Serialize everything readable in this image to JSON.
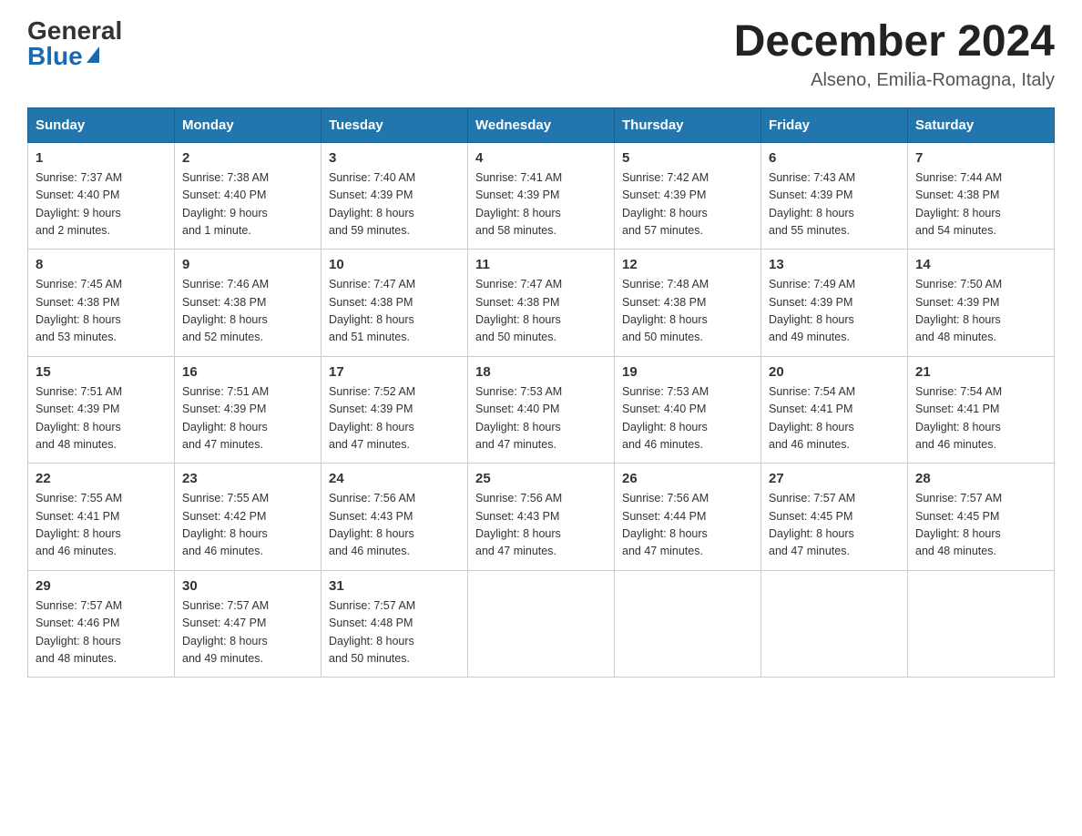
{
  "logo": {
    "general": "General",
    "blue": "Blue"
  },
  "title": "December 2024",
  "subtitle": "Alseno, Emilia-Romagna, Italy",
  "days_of_week": [
    "Sunday",
    "Monday",
    "Tuesday",
    "Wednesday",
    "Thursday",
    "Friday",
    "Saturday"
  ],
  "weeks": [
    [
      {
        "day": "1",
        "sunrise": "7:37 AM",
        "sunset": "4:40 PM",
        "daylight": "9 hours and 2 minutes."
      },
      {
        "day": "2",
        "sunrise": "7:38 AM",
        "sunset": "4:40 PM",
        "daylight": "9 hours and 1 minute."
      },
      {
        "day": "3",
        "sunrise": "7:40 AM",
        "sunset": "4:39 PM",
        "daylight": "8 hours and 59 minutes."
      },
      {
        "day": "4",
        "sunrise": "7:41 AM",
        "sunset": "4:39 PM",
        "daylight": "8 hours and 58 minutes."
      },
      {
        "day": "5",
        "sunrise": "7:42 AM",
        "sunset": "4:39 PM",
        "daylight": "8 hours and 57 minutes."
      },
      {
        "day": "6",
        "sunrise": "7:43 AM",
        "sunset": "4:39 PM",
        "daylight": "8 hours and 55 minutes."
      },
      {
        "day": "7",
        "sunrise": "7:44 AM",
        "sunset": "4:38 PM",
        "daylight": "8 hours and 54 minutes."
      }
    ],
    [
      {
        "day": "8",
        "sunrise": "7:45 AM",
        "sunset": "4:38 PM",
        "daylight": "8 hours and 53 minutes."
      },
      {
        "day": "9",
        "sunrise": "7:46 AM",
        "sunset": "4:38 PM",
        "daylight": "8 hours and 52 minutes."
      },
      {
        "day": "10",
        "sunrise": "7:47 AM",
        "sunset": "4:38 PM",
        "daylight": "8 hours and 51 minutes."
      },
      {
        "day": "11",
        "sunrise": "7:47 AM",
        "sunset": "4:38 PM",
        "daylight": "8 hours and 50 minutes."
      },
      {
        "day": "12",
        "sunrise": "7:48 AM",
        "sunset": "4:38 PM",
        "daylight": "8 hours and 50 minutes."
      },
      {
        "day": "13",
        "sunrise": "7:49 AM",
        "sunset": "4:39 PM",
        "daylight": "8 hours and 49 minutes."
      },
      {
        "day": "14",
        "sunrise": "7:50 AM",
        "sunset": "4:39 PM",
        "daylight": "8 hours and 48 minutes."
      }
    ],
    [
      {
        "day": "15",
        "sunrise": "7:51 AM",
        "sunset": "4:39 PM",
        "daylight": "8 hours and 48 minutes."
      },
      {
        "day": "16",
        "sunrise": "7:51 AM",
        "sunset": "4:39 PM",
        "daylight": "8 hours and 47 minutes."
      },
      {
        "day": "17",
        "sunrise": "7:52 AM",
        "sunset": "4:39 PM",
        "daylight": "8 hours and 47 minutes."
      },
      {
        "day": "18",
        "sunrise": "7:53 AM",
        "sunset": "4:40 PM",
        "daylight": "8 hours and 47 minutes."
      },
      {
        "day": "19",
        "sunrise": "7:53 AM",
        "sunset": "4:40 PM",
        "daylight": "8 hours and 46 minutes."
      },
      {
        "day": "20",
        "sunrise": "7:54 AM",
        "sunset": "4:41 PM",
        "daylight": "8 hours and 46 minutes."
      },
      {
        "day": "21",
        "sunrise": "7:54 AM",
        "sunset": "4:41 PM",
        "daylight": "8 hours and 46 minutes."
      }
    ],
    [
      {
        "day": "22",
        "sunrise": "7:55 AM",
        "sunset": "4:41 PM",
        "daylight": "8 hours and 46 minutes."
      },
      {
        "day": "23",
        "sunrise": "7:55 AM",
        "sunset": "4:42 PM",
        "daylight": "8 hours and 46 minutes."
      },
      {
        "day": "24",
        "sunrise": "7:56 AM",
        "sunset": "4:43 PM",
        "daylight": "8 hours and 46 minutes."
      },
      {
        "day": "25",
        "sunrise": "7:56 AM",
        "sunset": "4:43 PM",
        "daylight": "8 hours and 47 minutes."
      },
      {
        "day": "26",
        "sunrise": "7:56 AM",
        "sunset": "4:44 PM",
        "daylight": "8 hours and 47 minutes."
      },
      {
        "day": "27",
        "sunrise": "7:57 AM",
        "sunset": "4:45 PM",
        "daylight": "8 hours and 47 minutes."
      },
      {
        "day": "28",
        "sunrise": "7:57 AM",
        "sunset": "4:45 PM",
        "daylight": "8 hours and 48 minutes."
      }
    ],
    [
      {
        "day": "29",
        "sunrise": "7:57 AM",
        "sunset": "4:46 PM",
        "daylight": "8 hours and 48 minutes."
      },
      {
        "day": "30",
        "sunrise": "7:57 AM",
        "sunset": "4:47 PM",
        "daylight": "8 hours and 49 minutes."
      },
      {
        "day": "31",
        "sunrise": "7:57 AM",
        "sunset": "4:48 PM",
        "daylight": "8 hours and 50 minutes."
      },
      null,
      null,
      null,
      null
    ]
  ],
  "labels": {
    "sunrise": "Sunrise:",
    "sunset": "Sunset:",
    "daylight": "Daylight:"
  }
}
